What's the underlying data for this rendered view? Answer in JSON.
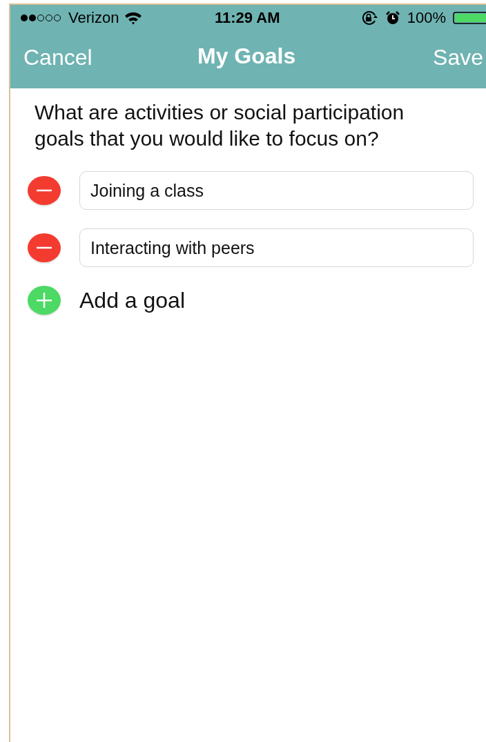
{
  "status_bar": {
    "carrier": "Verizon",
    "time": "11:29 AM",
    "battery": "100%"
  },
  "nav": {
    "left": "Cancel",
    "title": "My Goals",
    "right": "Save"
  },
  "question": "What are activities or social participation goals that you would like to focus on?",
  "goals": [
    {
      "value": "Joining a class"
    },
    {
      "value": "Interacting with peers"
    }
  ],
  "add_label": "Add a goal"
}
